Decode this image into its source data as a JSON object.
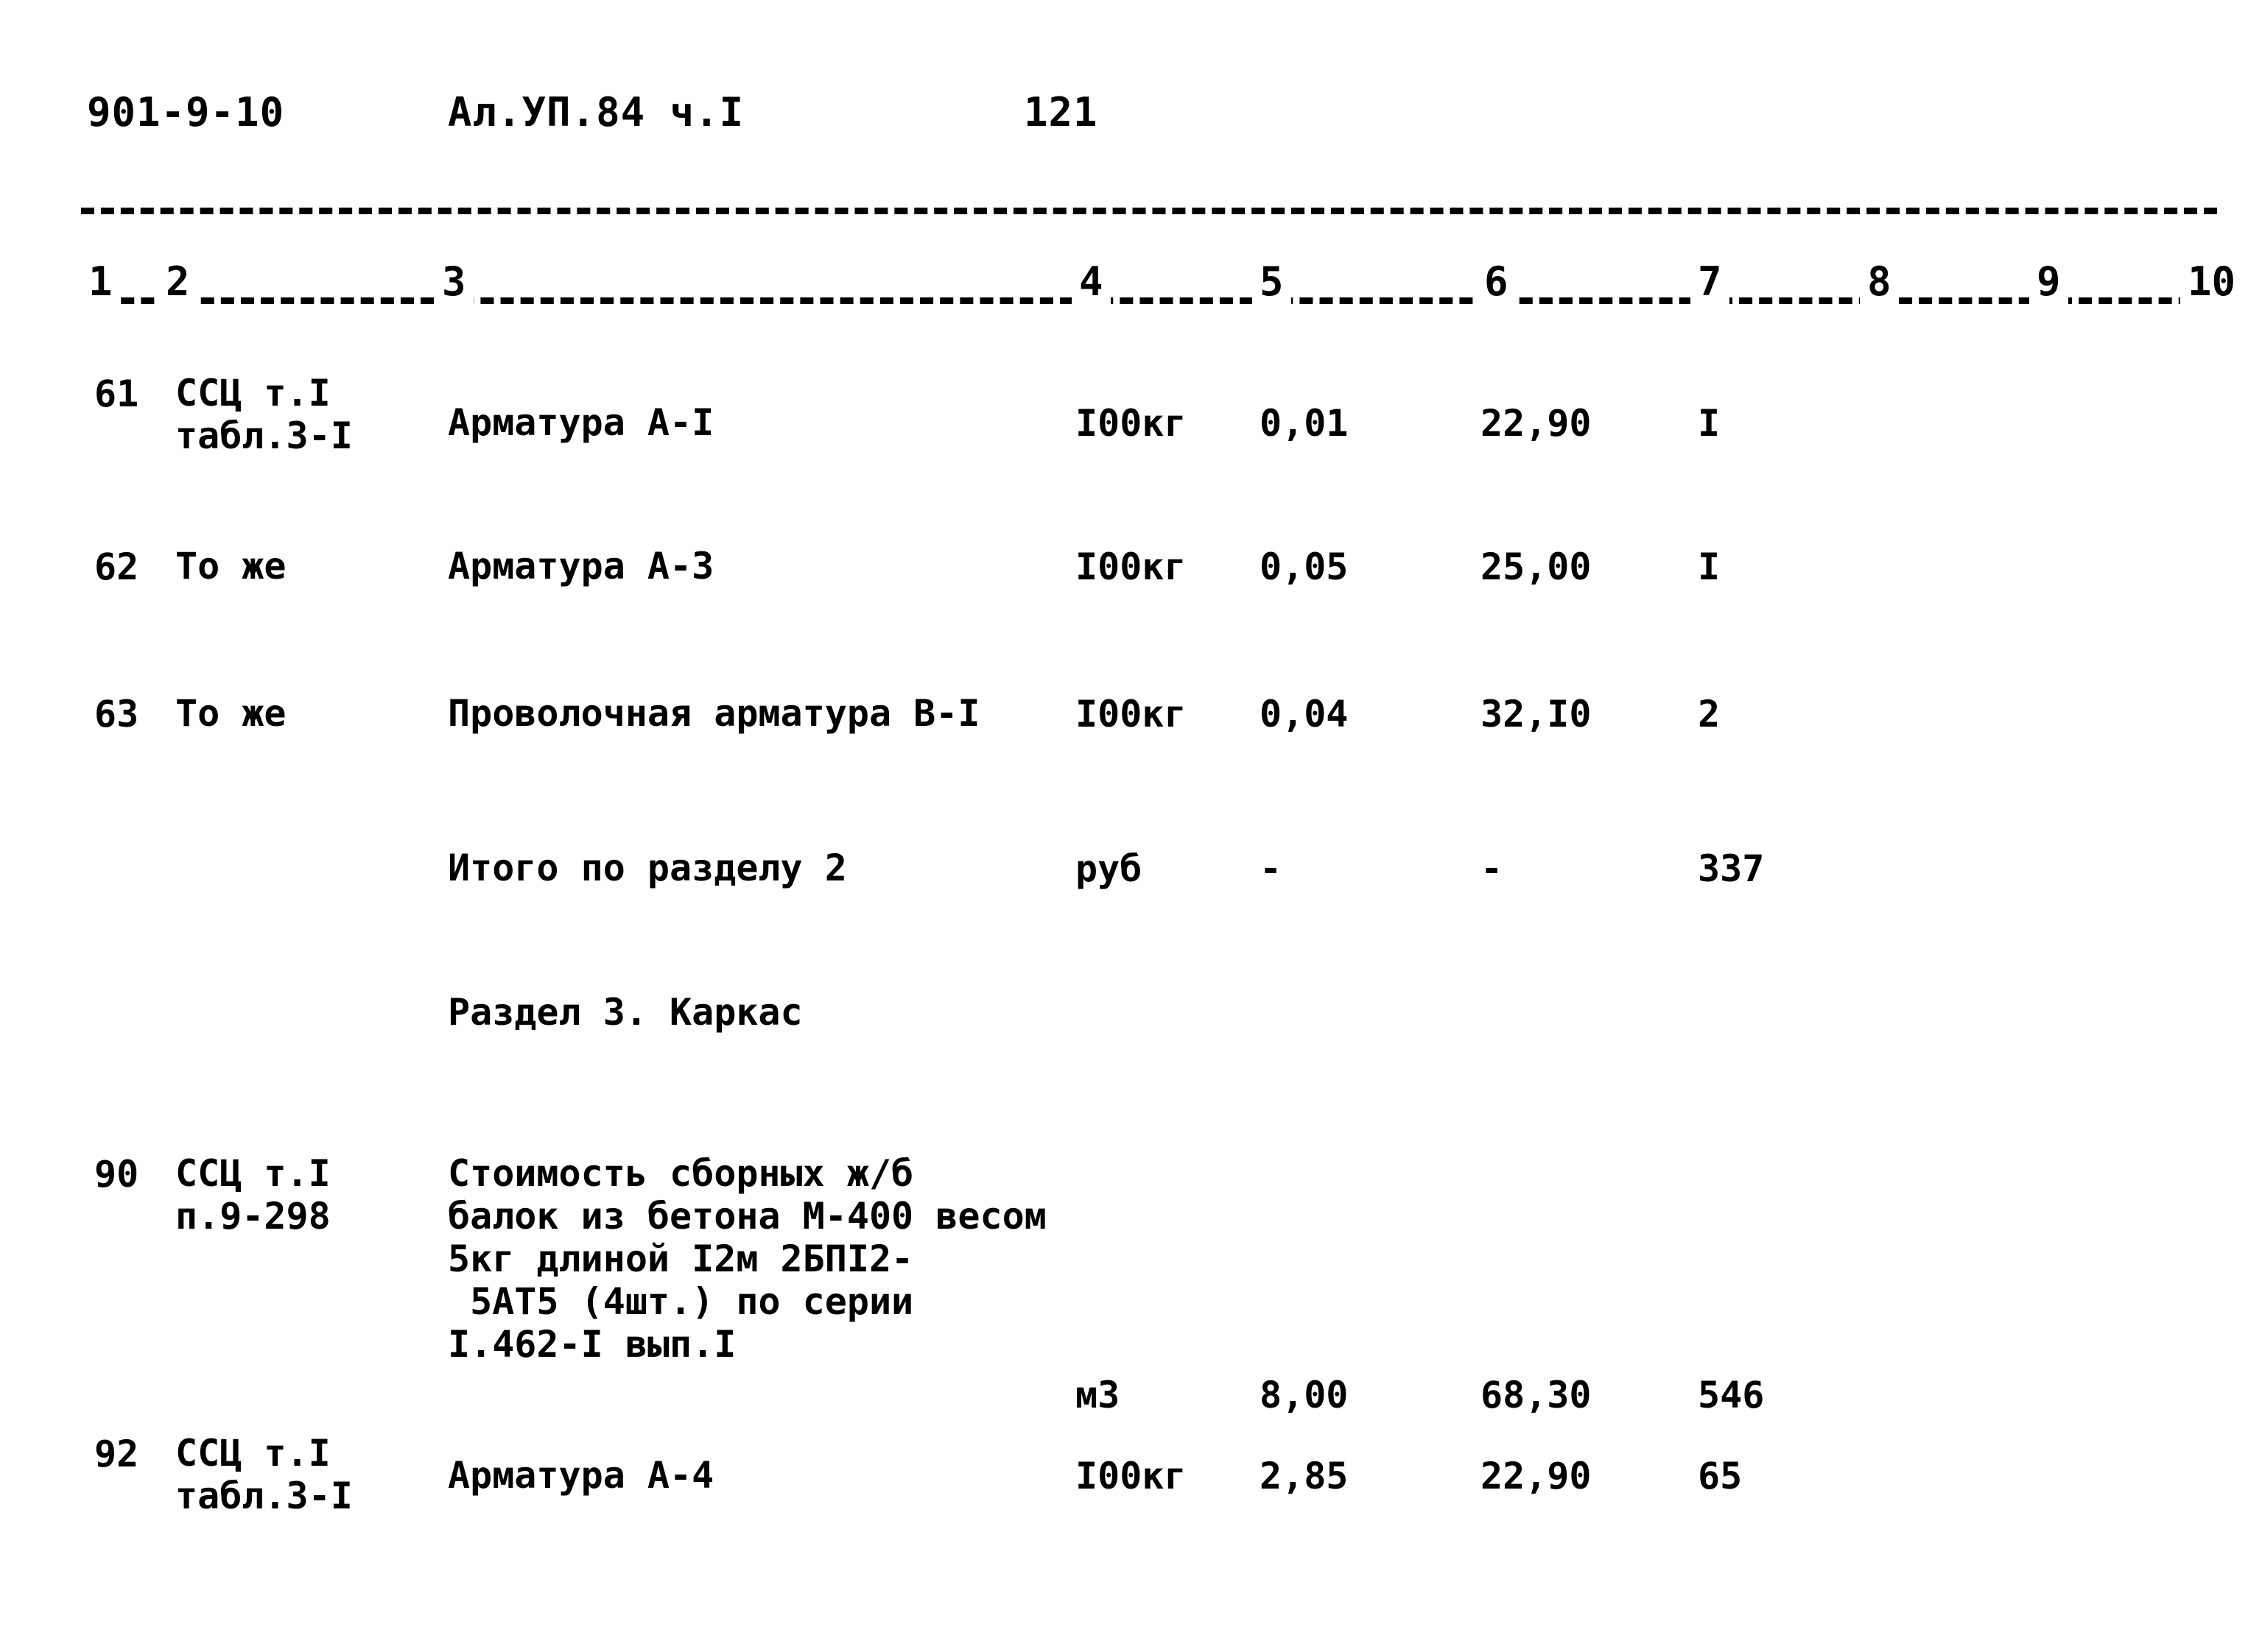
{
  "header": {
    "doc_code": "901-9-10",
    "album": "Ал.УП.84 ч.I",
    "page_number": "121"
  },
  "column_numbers": [
    "1",
    "2",
    "3",
    "4",
    "5",
    "6",
    "7",
    "8",
    "9",
    "10"
  ],
  "rows": [
    {
      "num": "61",
      "justification": "ССЦ т.I\nтабл.3-I",
      "description": "Арматура А-I",
      "unit": "I00кг",
      "quantity": "0,01",
      "price": "22,90",
      "total": "I"
    },
    {
      "num": "62",
      "justification": "То же",
      "description": "Арматура А-3",
      "unit": "I00кг",
      "quantity": "0,05",
      "price": "25,00",
      "total": "I"
    },
    {
      "num": "63",
      "justification": "То же",
      "description": "Проволочная арматура В-I",
      "unit": "I00кг",
      "quantity": "0,04",
      "price": "32,I0",
      "total": "2"
    },
    {
      "num": "",
      "justification": "",
      "description": "Итого по разделу 2",
      "unit": "руб",
      "quantity": "-",
      "price": "-",
      "total": "337"
    },
    {
      "num": "90",
      "justification": "ССЦ т.I\nп.9-298",
      "description": "Стоимость сборных ж/б\nбалок из бетона М-400 весом\n5кг длиной I2м 2БПI2-\n 5АТ5 (4шт.) по серии\nI.462-I вып.I",
      "unit": "м3",
      "quantity": "8,00",
      "price": "68,30",
      "total": "546"
    },
    {
      "num": "92",
      "justification": "ССЦ т.I\nтабл.3-I",
      "description": "Арматура А-4",
      "unit": "I00кг",
      "quantity": "2,85",
      "price": "22,90",
      "total": "65"
    }
  ],
  "section_heading": "Раздел 3. Каркас"
}
